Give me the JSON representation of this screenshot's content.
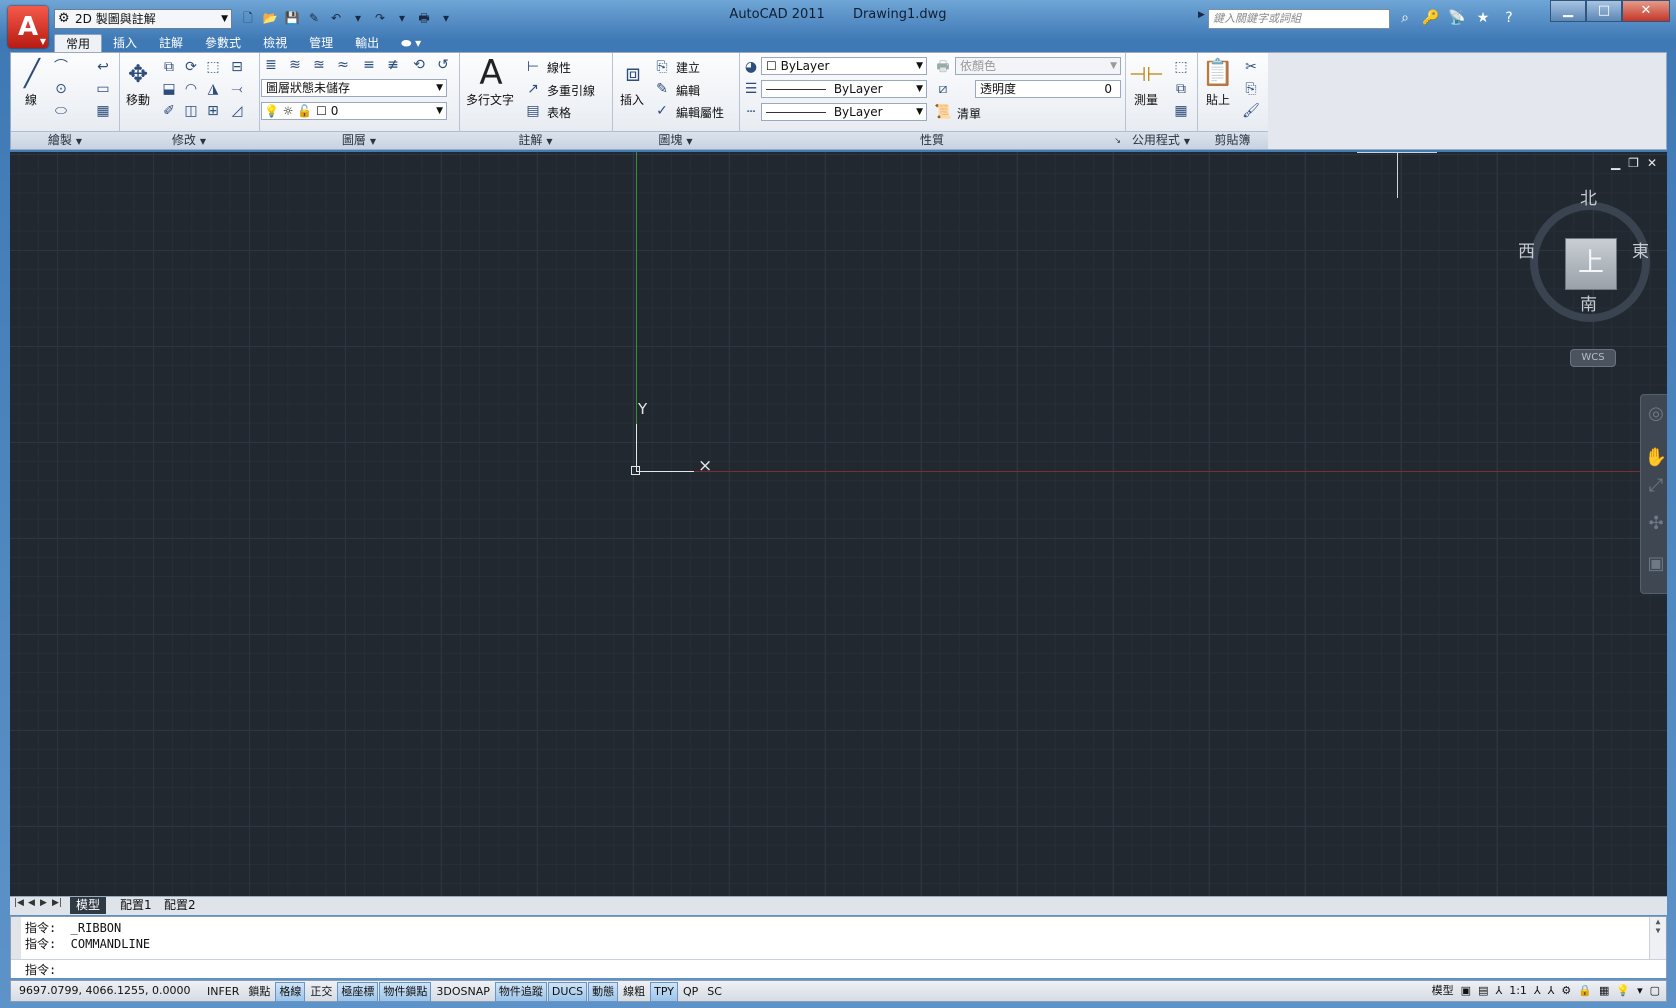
{
  "app": {
    "name": "AutoCAD 2011",
    "document": "Drawing1.dwg",
    "logo_letter": "A",
    "workspace": "2D 製圖與註解",
    "search_placeholder": "鍵入關鍵字或詞組"
  },
  "window_controls": {
    "minimize": "▁",
    "maximize": "□",
    "close": "✕"
  },
  "ribbon_tabs": [
    "常用",
    "插入",
    "註解",
    "參數式",
    "檢視",
    "管理",
    "輸出"
  ],
  "panels": {
    "draw": {
      "title": "繪製",
      "line_label": "線"
    },
    "modify": {
      "title": "修改",
      "move_label": "移動"
    },
    "layers": {
      "title": "圖層",
      "layer_state": "圖層狀態未儲存",
      "current_layer": "0"
    },
    "annotation": {
      "title": "註解",
      "mtext_label": "多行文字",
      "linear_label": "線性",
      "mleader_label": "多重引線",
      "table_label": "表格"
    },
    "block": {
      "title": "圖塊",
      "insert_label": "插入",
      "create_label": "建立",
      "edit_label": "編輯",
      "edit_attr_label": "編輯屬性"
    },
    "properties": {
      "title": "性質",
      "color": "ByLayer",
      "lineweight": "ByLayer",
      "linetype": "ByLayer",
      "plot_style": "依顏色",
      "transparency_label": "透明度",
      "transparency_value": "0",
      "list_label": "清單"
    },
    "utilities": {
      "title": "公用程式",
      "measure_label": "測量"
    },
    "clipboard": {
      "title": "剪貼簿",
      "paste_label": "貼上"
    }
  },
  "viewport": {
    "ucs_y": "Y",
    "ucs_x": "×",
    "viewcube": {
      "north": "北",
      "south": "南",
      "east": "東",
      "west": "西",
      "face": "上",
      "wcs": "WCS"
    }
  },
  "layout_tabs": [
    "模型",
    "配置1",
    "配置2"
  ],
  "command_line": {
    "history": [
      "指令:  _RIBBON",
      "指令:  COMMANDLINE"
    ],
    "prompt": "指令:"
  },
  "status_bar": {
    "coordinates": "9697.0799, 4066.1255, 0.0000",
    "toggles": [
      {
        "label": "INFER",
        "on": false
      },
      {
        "label": "鎖點",
        "on": false
      },
      {
        "label": "格線",
        "on": true
      },
      {
        "label": "正交",
        "on": false
      },
      {
        "label": "極座標",
        "on": true
      },
      {
        "label": "物件鎖點",
        "on": true
      },
      {
        "label": "3DOSNAP",
        "on": false
      },
      {
        "label": "物件追蹤",
        "on": true
      },
      {
        "label": "DUCS",
        "on": true
      },
      {
        "label": "動態",
        "on": true
      },
      {
        "label": "線粗",
        "on": false
      },
      {
        "label": "TPY",
        "on": true
      },
      {
        "label": "QP",
        "on": false
      },
      {
        "label": "SC",
        "on": false
      }
    ],
    "model_label": "模型",
    "scale": "1:1"
  }
}
